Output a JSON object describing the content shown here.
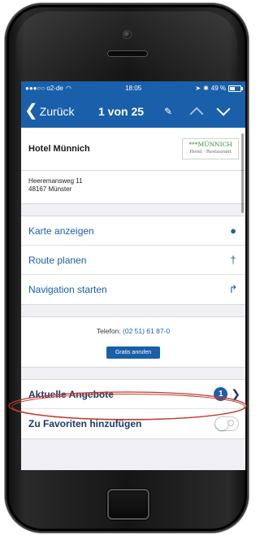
{
  "status_bar": {
    "carrier": "●●●○○ o2-de",
    "time": "18:05",
    "battery_text": "49 %"
  },
  "nav": {
    "back_label": "Zurück",
    "counter": "1 von 25"
  },
  "hotel": {
    "name": "Hotel Münnich",
    "logo_line1": "***MÜNNICH",
    "logo_line2": "Hotel · Restaurant",
    "address_line1": "Heeremansweg 11",
    "address_line2": "48167 Münster"
  },
  "actions": [
    {
      "label": "Karte anzeigen",
      "icon": "map-pin-icon"
    },
    {
      "label": "Route planen",
      "icon": "route-sign-icon"
    },
    {
      "label": "Navigation starten",
      "icon": "turn-right-arrow-icon"
    }
  ],
  "contact": {
    "phone_label": "Telefon:",
    "phone_number": "(02 51) 61 87-0",
    "call_button": "Gratis anrufen"
  },
  "offers": {
    "label": "Aktuelle Angebote",
    "badge": "1"
  },
  "favorites": {
    "label": "Zu Favoriten hinzufügen",
    "toggle_on": false
  },
  "colors": {
    "accent": "#1a5fa9",
    "highlight_ellipse": "#c0392b",
    "background": "#efeff4"
  }
}
